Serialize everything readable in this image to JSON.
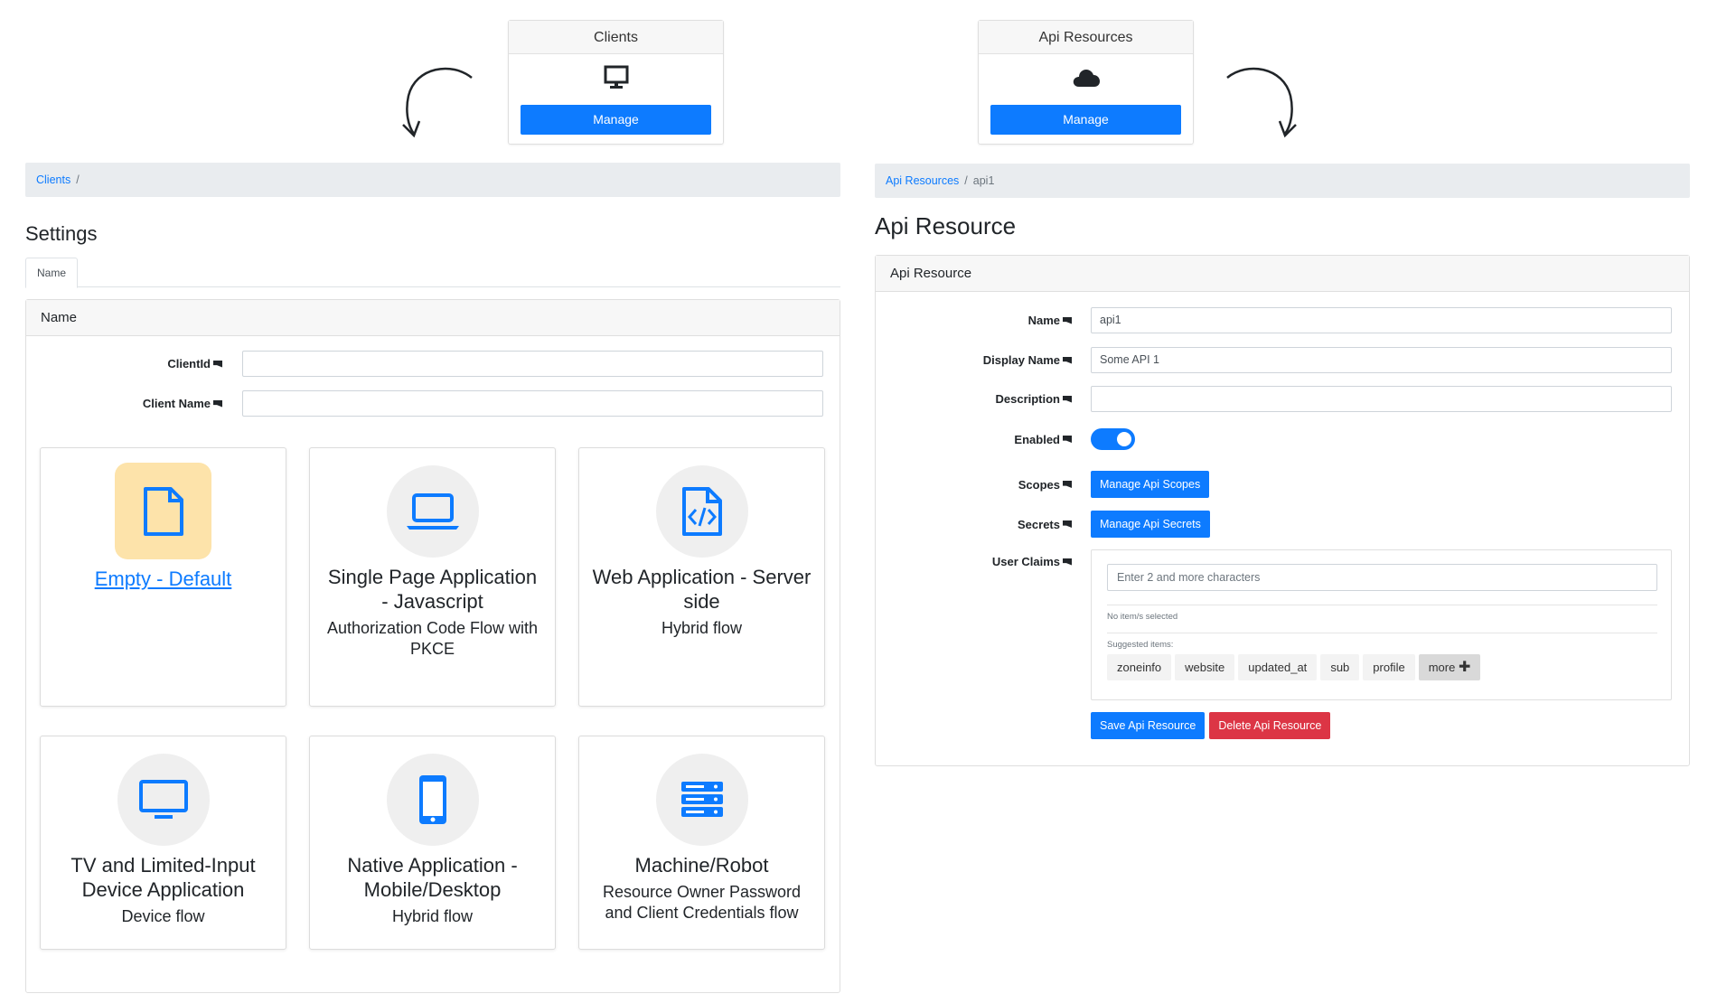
{
  "top_cards": {
    "clients": {
      "title": "Clients",
      "button": "Manage",
      "icon": "desktop-icon"
    },
    "api_resources": {
      "title": "Api Resources",
      "button": "Manage",
      "icon": "cloud-icon"
    }
  },
  "left": {
    "breadcrumb": {
      "link": "Clients",
      "sep": "/"
    },
    "title": "Settings",
    "tab": "Name",
    "card_header": "Name",
    "fields": [
      {
        "label": "ClientId",
        "value": ""
      },
      {
        "label": "Client Name",
        "value": ""
      }
    ],
    "tiles": [
      {
        "title": "Empty - Default",
        "subtitle": "",
        "icon": "file-icon",
        "selected": true
      },
      {
        "title": "Single Page Application - Javascript",
        "subtitle": "Authorization Code Flow with PKCE",
        "icon": "laptop-icon",
        "selected": false
      },
      {
        "title": "Web Application - Server side",
        "subtitle": "Hybrid flow",
        "icon": "code-file-icon",
        "selected": false
      },
      {
        "title": "TV and Limited-Input Device Application",
        "subtitle": "Device flow",
        "icon": "tv-icon",
        "selected": false
      },
      {
        "title": "Native Application - Mobile/Desktop",
        "subtitle": "Hybrid flow",
        "icon": "mobile-icon",
        "selected": false
      },
      {
        "title": "Machine/Robot",
        "subtitle": "Resource Owner Password and Client Credentials flow",
        "icon": "server-icon",
        "selected": false
      }
    ]
  },
  "right": {
    "breadcrumb": {
      "link": "Api Resources",
      "sep": "/",
      "current": "api1"
    },
    "title": "Api Resource",
    "card_header": "Api Resource",
    "labels": {
      "name": "Name",
      "display_name": "Display Name",
      "description": "Description",
      "enabled": "Enabled",
      "scopes": "Scopes",
      "secrets": "Secrets",
      "user_claims": "User Claims"
    },
    "values": {
      "name": "api1",
      "display_name": "Some API 1",
      "description": "",
      "enabled": true
    },
    "buttons": {
      "manage_scopes": "Manage Api Scopes",
      "manage_secrets": "Manage Api Secrets",
      "save": "Save Api Resource",
      "delete": "Delete Api Resource"
    },
    "claims": {
      "placeholder": "Enter 2 and more characters",
      "none_selected": "No item/s selected",
      "suggested_label": "Suggested items:",
      "suggested": [
        "zoneinfo",
        "website",
        "updated_at",
        "sub",
        "profile"
      ],
      "more": "more"
    }
  },
  "colors": {
    "primary": "#0d7bff",
    "danger": "#dc3545",
    "breadcrumb_bg": "#e9ecef",
    "selected_tile": "#fde3aa"
  }
}
